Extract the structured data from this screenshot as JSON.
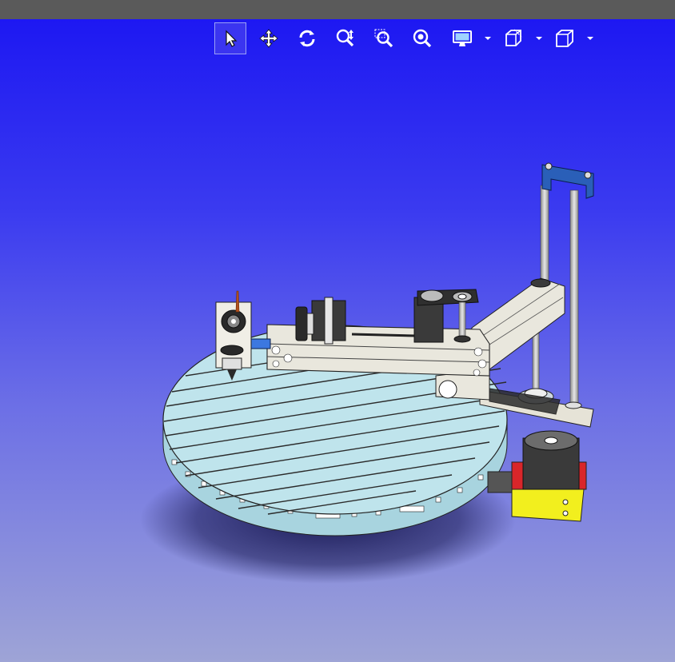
{
  "window": {
    "title": ""
  },
  "toolbar": {
    "items": [
      {
        "name": "select-tool",
        "icon": "cursor-arrow-icon",
        "active": true
      },
      {
        "name": "pan-tool",
        "icon": "move-arrows-icon"
      },
      {
        "name": "rotate-tool",
        "icon": "rotate-icon"
      },
      {
        "name": "zoom-tool",
        "icon": "zoom-updown-icon"
      },
      {
        "name": "zoom-window-tool",
        "icon": "zoom-window-icon"
      },
      {
        "name": "zoom-fit-tool",
        "icon": "zoom-fit-icon"
      },
      {
        "name": "display-mode",
        "icon": "monitor-icon",
        "dropdown": true
      },
      {
        "name": "section-view",
        "icon": "section-box-icon",
        "dropdown": true
      },
      {
        "name": "view-orientation",
        "icon": "cube-view-icon",
        "dropdown": true
      }
    ]
  },
  "viewport": {
    "background_top": "#1d18f2",
    "background_bottom": "#9ea4d6",
    "model": "scara-robot-assembly"
  },
  "colors": {
    "accent": "#3b35f0",
    "part_light": "#e9e7dd",
    "part_dark": "#2a2a2a",
    "platform": "#b9e0ea",
    "bracket_blue": "#2a5fb8",
    "base_yellow": "#f2ef1e",
    "base_red": "#d9262a"
  }
}
